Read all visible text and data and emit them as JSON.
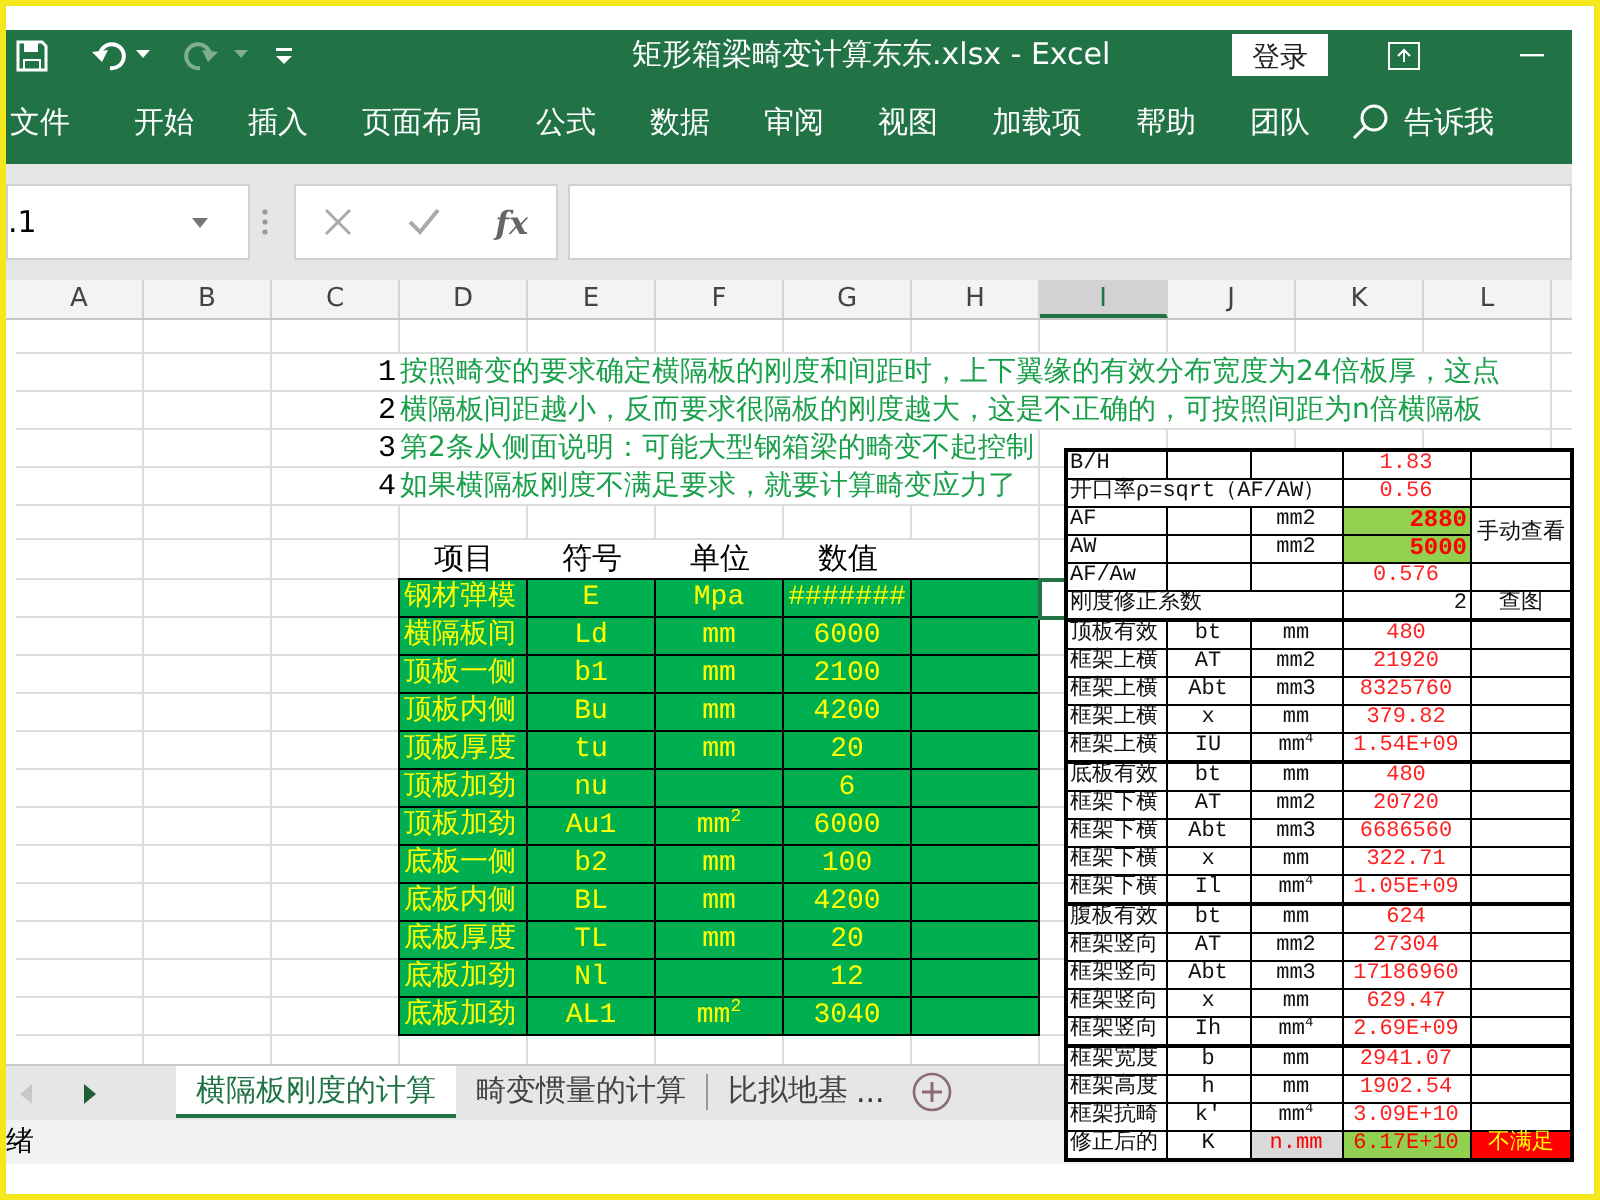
{
  "window": {
    "title": "矩形箱梁畸变计算东东.xlsx  -  Excel",
    "login": "登录"
  },
  "ribbon_tabs": [
    "文件",
    "开始",
    "插入",
    "页面布局",
    "公式",
    "数据",
    "审阅",
    "视图",
    "加载项",
    "帮助",
    "团队"
  ],
  "tell_me": "告诉我",
  "formula_bar": {
    "name_box": ".1",
    "fx": "fx"
  },
  "columns": [
    {
      "label": "A",
      "selected": false
    },
    {
      "label": "B",
      "selected": false
    },
    {
      "label": "C",
      "selected": false
    },
    {
      "label": "D",
      "selected": false
    },
    {
      "label": "E",
      "selected": false
    },
    {
      "label": "F",
      "selected": false
    },
    {
      "label": "G",
      "selected": false
    },
    {
      "label": "H",
      "selected": false
    },
    {
      "label": "I",
      "selected": true
    },
    {
      "label": "J",
      "selected": false
    },
    {
      "label": "K",
      "selected": false
    },
    {
      "label": "L",
      "selected": false
    }
  ],
  "notes": [
    {
      "number": "1",
      "text": "按照畸变的要求确定横隔板的刚度和间距时，上下翼缘的有效分布宽度为24倍板厚，这点"
    },
    {
      "number": "2",
      "text": "横隔板间距越小，反而要求很隔板的刚度越大，这是不正确的，可按照间距为n倍横隔板"
    },
    {
      "number": "3",
      "text": "第2条从侧面说明：可能大型钢箱梁的畸变不起控制"
    },
    {
      "number": "4",
      "text": "如果横隔板刚度不满足要求，就要计算畸变应力了"
    }
  ],
  "params_table": {
    "columns": [
      "项目",
      "符号",
      "单位",
      "数值"
    ],
    "rows": [
      {
        "item": "钢材弹模",
        "symbol": "E",
        "unit": "Mpa",
        "value": "#######"
      },
      {
        "item": "横隔板间",
        "symbol": "Ld",
        "unit": "mm",
        "value": "6000"
      },
      {
        "item": "顶板一侧",
        "symbol": "b1",
        "unit": "mm",
        "value": "2100"
      },
      {
        "item": "顶板内侧",
        "symbol": "Bu",
        "unit": "mm",
        "value": "4200"
      },
      {
        "item": "顶板厚度",
        "symbol": "tu",
        "unit": "mm",
        "value": "20"
      },
      {
        "item": "顶板加劲",
        "symbol": "nu",
        "value": "6"
      },
      {
        "item": "顶板加劲",
        "symbol": "Au1",
        "unit": "mm$^{2}$",
        "value": "6000"
      },
      {
        "item": "底板一侧",
        "symbol": "b2",
        "unit": "mm",
        "value": "100"
      },
      {
        "item": "底板内侧",
        "symbol": "BL",
        "unit": "mm",
        "value": "4200"
      },
      {
        "item": "底板厚度",
        "symbol": "TL",
        "unit": "mm",
        "value": "20"
      },
      {
        "item": "底板加劲",
        "symbol": "Nl",
        "value": "12"
      },
      {
        "item": "底板加劲",
        "symbol": "AL1",
        "unit": "mm$^{2}$",
        "value": "3040"
      }
    ]
  },
  "calc_table": {
    "groups": [
      {
        "rows": [
          {
            "cells": [
              {
                "kind": "label",
                "text": "B/H"
              },
              {
                "kind": "blank"
              },
              {
                "kind": "blank"
              },
              {
                "kind": "value",
                "text": "1.83"
              },
              {
                "kind": "blank"
              }
            ]
          },
          {
            "cells": [
              {
                "kind": "label",
                "text": "开口率ρ=sqrt（AF/AW）",
                "colspan": 3
              },
              {
                "kind": "value",
                "text": "0.56"
              },
              {
                "kind": "blank"
              }
            ]
          },
          {
            "cells": [
              {
                "kind": "label",
                "text": "AF"
              },
              {
                "kind": "blank"
              },
              {
                "kind": "unit",
                "text": "mm2"
              },
              {
                "kind": "input",
                "text": "2880"
              },
              {
                "kind": "label",
                "text": "手动查看",
                "rowspan": 2
              }
            ]
          },
          {
            "cells": [
              {
                "kind": "label",
                "text": "AW"
              },
              {
                "kind": "blank"
              },
              {
                "kind": "unit",
                "text": "mm2"
              },
              {
                "kind": "input",
                "text": "5000"
              }
            ]
          },
          {
            "cells": [
              {
                "kind": "label",
                "text": "AF/Aw"
              },
              {
                "kind": "blank"
              },
              {
                "kind": "blank"
              },
              {
                "kind": "value",
                "text": "0.576"
              },
              {
                "kind": "blank"
              }
            ]
          },
          {
            "cells": [
              {
                "kind": "label",
                "text": "刚度修正系数",
                "colspan": 3
              },
              {
                "kind": "number",
                "text": "2"
              },
              {
                "kind": "center",
                "text": "查图"
              }
            ]
          }
        ]
      },
      {
        "rows": [
          {
            "cells": [
              {
                "kind": "label",
                "text": "顶板有效"
              },
              {
                "kind": "center",
                "text": "bt"
              },
              {
                "kind": "unit",
                "text": "mm"
              },
              {
                "kind": "value",
                "text": "480"
              },
              {
                "kind": "blank"
              }
            ]
          },
          {
            "cells": [
              {
                "kind": "label",
                "text": "框架上横"
              },
              {
                "kind": "center",
                "text": "AT"
              },
              {
                "kind": "unit",
                "text": "mm2"
              },
              {
                "kind": "value",
                "text": "21920"
              },
              {
                "kind": "blank"
              }
            ]
          },
          {
            "cells": [
              {
                "kind": "label",
                "text": "框架上横"
              },
              {
                "kind": "center",
                "text": "Abt"
              },
              {
                "kind": "unit",
                "text": "mm3"
              },
              {
                "kind": "value",
                "text": "8325760"
              },
              {
                "kind": "blank"
              }
            ]
          },
          {
            "cells": [
              {
                "kind": "label",
                "text": "框架上横"
              },
              {
                "kind": "center",
                "text": "x"
              },
              {
                "kind": "unit",
                "text": "mm"
              },
              {
                "kind": "value",
                "text": "379.82"
              },
              {
                "kind": "blank"
              }
            ]
          },
          {
            "cells": [
              {
                "kind": "label",
                "text": "框架上横"
              },
              {
                "kind": "center",
                "text": "IU"
              },
              {
                "kind": "unit",
                "text": "mm$^{4}$"
              },
              {
                "kind": "value",
                "text": "1.54E+09"
              },
              {
                "kind": "blank"
              }
            ]
          }
        ]
      },
      {
        "rows": [
          {
            "cells": [
              {
                "kind": "label",
                "text": "底板有效"
              },
              {
                "kind": "center",
                "text": "bt"
              },
              {
                "kind": "unit",
                "text": "mm"
              },
              {
                "kind": "value",
                "text": "480"
              },
              {
                "kind": "blank"
              }
            ]
          },
          {
            "cells": [
              {
                "kind": "label",
                "text": "框架下横"
              },
              {
                "kind": "center",
                "text": "AT"
              },
              {
                "kind": "unit",
                "text": "mm2"
              },
              {
                "kind": "value",
                "text": "20720"
              },
              {
                "kind": "blank"
              }
            ]
          },
          {
            "cells": [
              {
                "kind": "label",
                "text": "框架下横"
              },
              {
                "kind": "center",
                "text": "Abt"
              },
              {
                "kind": "unit",
                "text": "mm3"
              },
              {
                "kind": "value",
                "text": "6686560"
              },
              {
                "kind": "blank"
              }
            ]
          },
          {
            "cells": [
              {
                "kind": "label",
                "text": "框架下横"
              },
              {
                "kind": "center",
                "text": "x"
              },
              {
                "kind": "unit",
                "text": "mm"
              },
              {
                "kind": "value",
                "text": "322.71"
              },
              {
                "kind": "blank"
              }
            ]
          },
          {
            "cells": [
              {
                "kind": "label",
                "text": "框架下横"
              },
              {
                "kind": "center",
                "text": "Il"
              },
              {
                "kind": "unit",
                "text": "mm$^{4}$"
              },
              {
                "kind": "value",
                "text": "1.05E+09"
              },
              {
                "kind": "blank"
              }
            ]
          }
        ]
      },
      {
        "rows": [
          {
            "cells": [
              {
                "kind": "label",
                "text": "腹板有效"
              },
              {
                "kind": "center",
                "text": "bt"
              },
              {
                "kind": "unit",
                "text": "mm"
              },
              {
                "kind": "value",
                "text": "624"
              },
              {
                "kind": "blank"
              }
            ]
          },
          {
            "cells": [
              {
                "kind": "label",
                "text": "框架竖向"
              },
              {
                "kind": "center",
                "text": "AT"
              },
              {
                "kind": "unit",
                "text": "mm2"
              },
              {
                "kind": "value",
                "text": "27304"
              },
              {
                "kind": "blank"
              }
            ]
          },
          {
            "cells": [
              {
                "kind": "label",
                "text": "框架竖向"
              },
              {
                "kind": "center",
                "text": "Abt"
              },
              {
                "kind": "unit",
                "text": "mm3"
              },
              {
                "kind": "value",
                "text": "17186960"
              },
              {
                "kind": "blank"
              }
            ]
          },
          {
            "cells": [
              {
                "kind": "label",
                "text": "框架竖向"
              },
              {
                "kind": "center",
                "text": "x"
              },
              {
                "kind": "unit",
                "text": "mm"
              },
              {
                "kind": "value",
                "text": "629.47"
              },
              {
                "kind": "blank"
              }
            ]
          },
          {
            "cells": [
              {
                "kind": "label",
                "text": "框架竖向"
              },
              {
                "kind": "center",
                "text": "Ih"
              },
              {
                "kind": "unit",
                "text": "mm$^{4}$"
              },
              {
                "kind": "value",
                "text": "2.69E+09"
              },
              {
                "kind": "blank"
              }
            ]
          }
        ]
      },
      {
        "rows": [
          {
            "cells": [
              {
                "kind": "label",
                "text": "框架宽度"
              },
              {
                "kind": "center",
                "text": "b"
              },
              {
                "kind": "unit",
                "text": "mm"
              },
              {
                "kind": "value",
                "text": "2941.07"
              },
              {
                "kind": "blank"
              }
            ]
          },
          {
            "cells": [
              {
                "kind": "label",
                "text": "框架高度"
              },
              {
                "kind": "center",
                "text": "h"
              },
              {
                "kind": "unit",
                "text": "mm"
              },
              {
                "kind": "value",
                "text": "1902.54"
              },
              {
                "kind": "blank"
              }
            ]
          },
          {
            "cells": [
              {
                "kind": "label",
                "text": "框架抗畸"
              },
              {
                "kind": "center",
                "text": "k'"
              },
              {
                "kind": "unit",
                "text": "mm$^{4}$"
              },
              {
                "kind": "value",
                "text": "3.09E+10"
              },
              {
                "kind": "blank"
              }
            ]
          },
          {
            "cells": [
              {
                "kind": "label",
                "text": "修正后的"
              },
              {
                "kind": "center",
                "text": "K"
              },
              {
                "kind": "note",
                "text": "n.mm"
              },
              {
                "kind": "result",
                "text": "6.17E+10"
              },
              {
                "kind": "warn",
                "text": "不满足"
              }
            ]
          }
        ]
      }
    ]
  },
  "nav_buttons": [
    {
      "kind": "prev",
      "disabled": true
    },
    {
      "kind": "next",
      "disabled": false
    }
  ],
  "sheet_tabs": [
    {
      "label": "横隔板刚度的计算",
      "selected": true
    },
    {
      "label": "畸变惯量的计算",
      "selected": false
    },
    {
      "label": "比拟地基",
      "selected": false
    }
  ],
  "more_tabs": "...",
  "status_bar": "绪"
}
